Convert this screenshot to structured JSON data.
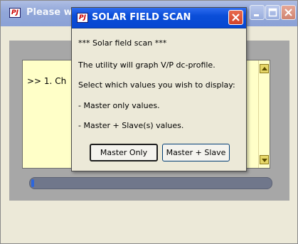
{
  "background_window": {
    "title": "Please wa",
    "icon": "PJ",
    "controls": {
      "minimize_icon": "minimize-icon",
      "maximize_icon": "maximize-icon",
      "close_icon": "close-icon"
    },
    "text_area": {
      "line": ">> 1. Ch"
    },
    "progress": {
      "fraction": 0.01
    }
  },
  "dialog": {
    "title": "SOLAR FIELD SCAN",
    "icon": "PJ",
    "message": {
      "line1": "*** Solar field scan ***",
      "line2": "The utility will graph V/P dc-profile.",
      "line3": "Select which values you wish to display:",
      "line4": "- Master only values.",
      "line5": "- Master + Slave(s) values."
    },
    "buttons": {
      "master_only": "Master Only",
      "master_slave": "Master + Slave"
    }
  },
  "colors": {
    "dialog_title_bar": "#0a4ed8",
    "inactive_title_bar": "#91a7d9",
    "text_area_bg": "#ffffc8",
    "progress_fill": "#2c66dd"
  }
}
